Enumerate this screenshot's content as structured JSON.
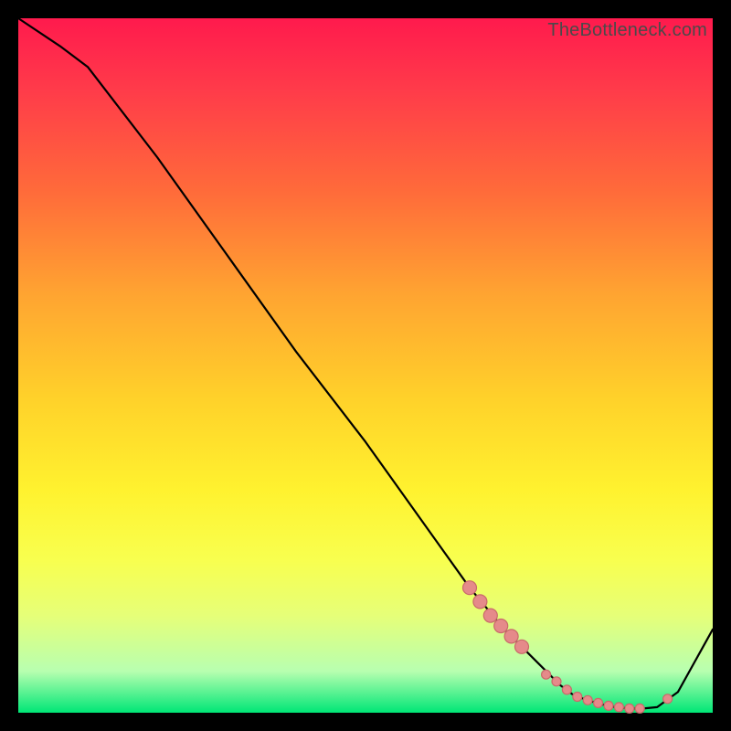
{
  "watermark": "TheBottleneck.com",
  "colors": {
    "gradient_top": "#ff1a4d",
    "gradient_mid": "#ffd22a",
    "gradient_bottom": "#00e676",
    "curve": "#000000",
    "dot_fill": "#e58a8a",
    "dot_stroke": "#c96a6a",
    "background": "#000000"
  },
  "chart_data": {
    "type": "line",
    "title": "",
    "xlabel": "",
    "ylabel": "",
    "xlim": [
      0,
      100
    ],
    "ylim": [
      0,
      100
    ],
    "series": [
      {
        "name": "bottleneck-curve",
        "x": [
          0,
          6,
          10,
          20,
          30,
          40,
          50,
          60,
          65,
          70,
          75,
          78,
          80,
          82,
          84,
          86,
          88,
          90,
          92,
          95,
          100
        ],
        "values": [
          100,
          96,
          93,
          80,
          66,
          52,
          39,
          25,
          18,
          12,
          7,
          4,
          2.5,
          1.8,
          1.2,
          0.8,
          0.6,
          0.6,
          0.8,
          3,
          12
        ]
      }
    ],
    "dots": {
      "name": "highlight-dots",
      "points": [
        {
          "x": 65.0,
          "y": 18.0,
          "size": "big"
        },
        {
          "x": 66.5,
          "y": 16.0,
          "size": "big"
        },
        {
          "x": 68.0,
          "y": 14.0,
          "size": "big"
        },
        {
          "x": 69.5,
          "y": 12.5,
          "size": "big"
        },
        {
          "x": 71.0,
          "y": 11.0,
          "size": "big"
        },
        {
          "x": 72.5,
          "y": 9.5,
          "size": "big"
        },
        {
          "x": 76.0,
          "y": 5.5,
          "size": "small"
        },
        {
          "x": 77.5,
          "y": 4.5,
          "size": "small"
        },
        {
          "x": 79.0,
          "y": 3.3,
          "size": "small"
        },
        {
          "x": 80.5,
          "y": 2.3,
          "size": "small"
        },
        {
          "x": 82.0,
          "y": 1.8,
          "size": "small"
        },
        {
          "x": 83.5,
          "y": 1.4,
          "size": "small"
        },
        {
          "x": 85.0,
          "y": 1.0,
          "size": "small"
        },
        {
          "x": 86.5,
          "y": 0.8,
          "size": "small"
        },
        {
          "x": 88.0,
          "y": 0.6,
          "size": "small"
        },
        {
          "x": 89.5,
          "y": 0.6,
          "size": "small"
        },
        {
          "x": 93.5,
          "y": 2.0,
          "size": "small"
        }
      ]
    }
  }
}
